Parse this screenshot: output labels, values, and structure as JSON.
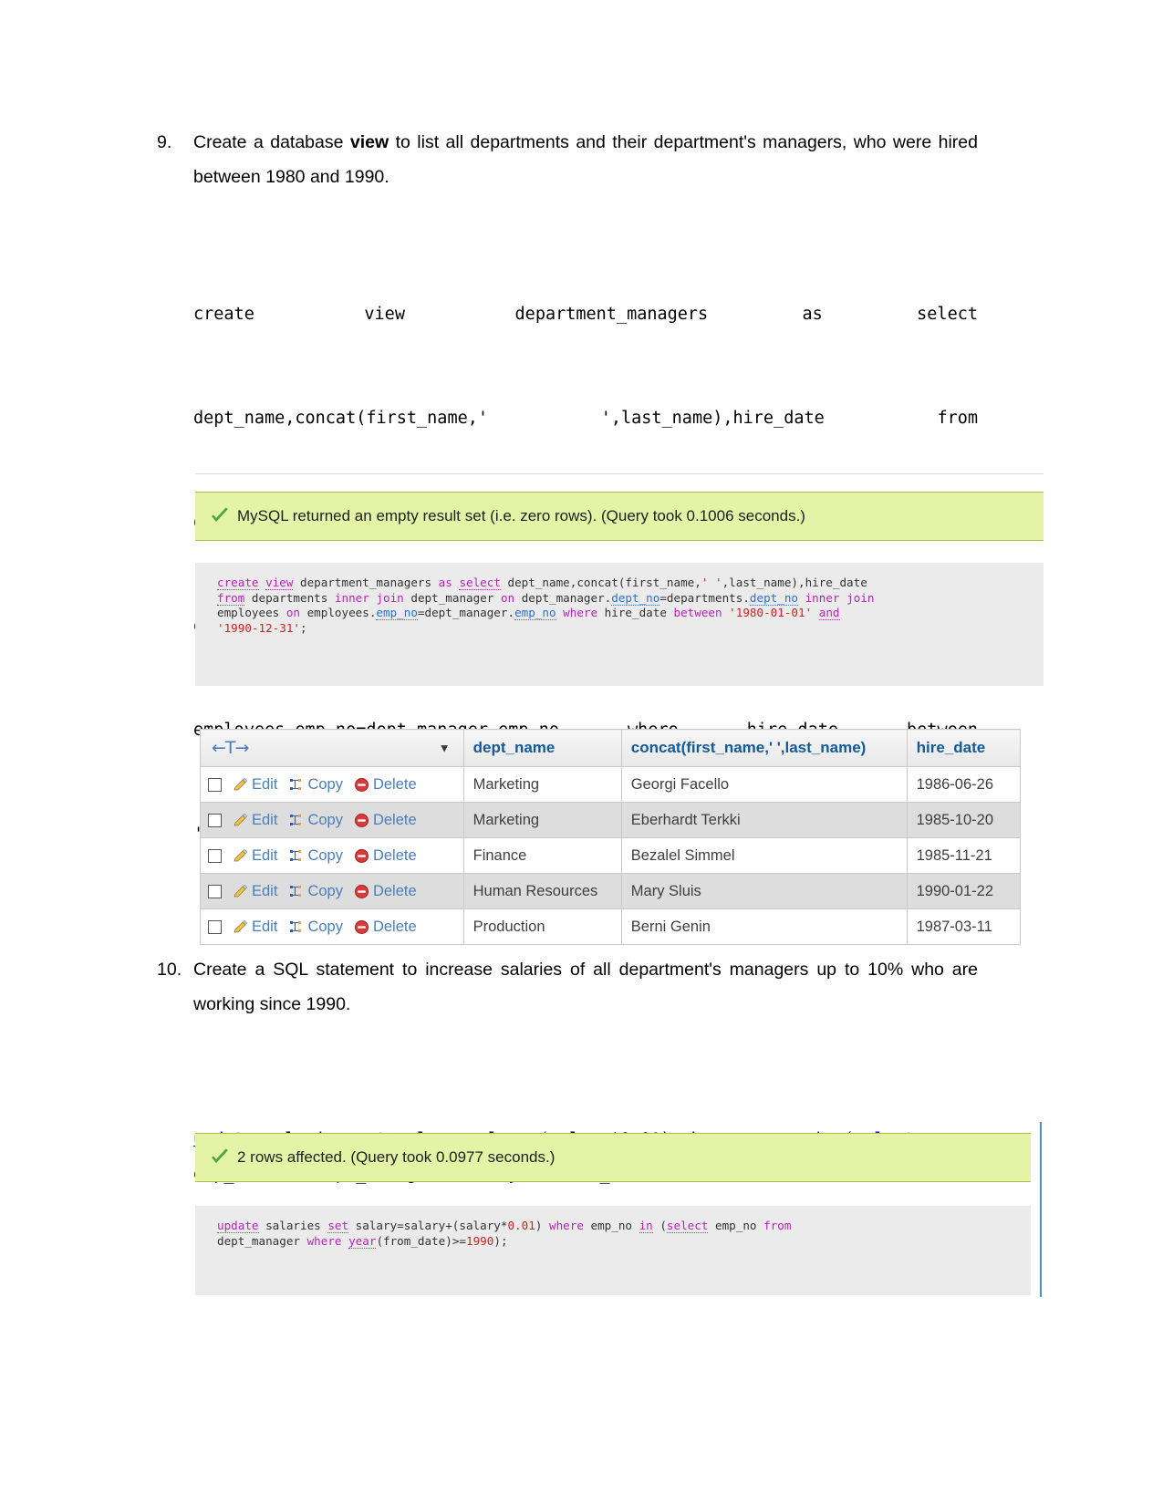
{
  "questions": [
    {
      "number": "9.",
      "text_parts": [
        {
          "t": "Create a database ",
          "b": false
        },
        {
          "t": "view",
          "b": true
        },
        {
          "t": " to list all departments and their department's managers, who were hired between 1980 and 1990.",
          "b": false
        }
      ],
      "full_text": "Create a database view to list all departments and their department's managers, who were hired between 1980 and 1990."
    },
    {
      "number": "10.",
      "text_parts": [
        {
          "t": "Create a SQL statement to increase salaries of all department's managers up to 10% who are working since 1990.",
          "b": false
        }
      ],
      "full_text": "Create a SQL statement to increase salaries of all department's managers up to 10% who are working since 1990."
    }
  ],
  "sql9": {
    "line1": "create       view       department_managers      as      select",
    "line2": "dept_name,concat(first_name,'     ',last_name),hire_date     from",
    "line3": "departments        inner        join        dept_manager        on",
    "line4": "dept_manager.dept_no=departments.dept_no inner join employees on",
    "line5": "employees.emp_no=dept_manager.emp_no   where   hire_date   between",
    "line6": "'1980-01-01' and '1990-12-31';",
    "full": "create view department_managers as select dept_name,concat(first_name,' ',last_name),hire_date from departments inner join dept_manager on dept_manager.dept_no=departments.dept_no inner join employees on employees.emp_no=dept_manager.emp_no where hire_date between '1980-01-01' and '1990-12-31';"
  },
  "sql10": {
    "seg": [
      {
        "t": "update",
        "kw": true
      },
      {
        "t": " salaries ",
        "kw": false
      },
      {
        "t": "set",
        "kw": true
      },
      {
        "t": " salary=salary+(salary*0.01) where emp_no ",
        "kw": false
      },
      {
        "t": "in",
        "kw": true
      },
      {
        "t": " (",
        "kw": false
      },
      {
        "t": "select",
        "kw": true
      },
      {
        "t": " emp_no from dept_manager where ",
        "kw": false
      },
      {
        "t": "year",
        "kw": true
      },
      {
        "t": "(from_date)>=1990);",
        "kw": false
      }
    ],
    "full": "update salaries set salary=salary+(salary*0.01) where emp_no in (select emp_no from dept_manager where year(from_date)>=1990);"
  },
  "result9": {
    "banner": "MySQL returned an empty result set (i.e. zero rows). (Query took 0.1006 seconds.)",
    "check_icon": "green-check-icon",
    "sqlbox": [
      [
        {
          "t": "create",
          "c": "res"
        },
        {
          "t": " ",
          "c": "plain"
        },
        {
          "t": "view",
          "c": "res"
        },
        {
          "t": " department_managers ",
          "c": "plain"
        },
        {
          "t": "as",
          "c": "res2"
        },
        {
          "t": " ",
          "c": "plain"
        },
        {
          "t": "select",
          "c": "res"
        },
        {
          "t": " dept_name,concat(first_name,",
          "c": "plain"
        },
        {
          "t": "' '",
          "c": "str"
        },
        {
          "t": ",last_name),hire_date",
          "c": "plain"
        }
      ],
      [
        {
          "t": "from",
          "c": "res"
        },
        {
          "t": " departments ",
          "c": "plain"
        },
        {
          "t": "inner",
          "c": "res2"
        },
        {
          "t": " ",
          "c": "plain"
        },
        {
          "t": "join",
          "c": "res2"
        },
        {
          "t": " dept_manager ",
          "c": "plain"
        },
        {
          "t": "on",
          "c": "res2"
        },
        {
          "t": " dept_manager.",
          "c": "plain"
        },
        {
          "t": "dept_no",
          "c": "col"
        },
        {
          "t": "=departments.",
          "c": "plain"
        },
        {
          "t": "dept_no",
          "c": "col"
        },
        {
          "t": " ",
          "c": "plain"
        },
        {
          "t": "inner",
          "c": "res2"
        },
        {
          "t": " ",
          "c": "plain"
        },
        {
          "t": "join",
          "c": "res2"
        }
      ],
      [
        {
          "t": "employees ",
          "c": "plain"
        },
        {
          "t": "on",
          "c": "res2"
        },
        {
          "t": " employees.",
          "c": "plain"
        },
        {
          "t": "emp_no",
          "c": "col"
        },
        {
          "t": "=dept_manager.",
          "c": "plain"
        },
        {
          "t": "emp_no",
          "c": "col"
        },
        {
          "t": " ",
          "c": "plain"
        },
        {
          "t": "where",
          "c": "res2"
        },
        {
          "t": " hire_date ",
          "c": "plain"
        },
        {
          "t": "between",
          "c": "res2"
        },
        {
          "t": " ",
          "c": "plain"
        },
        {
          "t": "'1980-01-01'",
          "c": "str"
        },
        {
          "t": " ",
          "c": "plain"
        },
        {
          "t": "and",
          "c": "res"
        }
      ],
      [
        {
          "t": "'1990-12-31'",
          "c": "str"
        },
        {
          "t": ";",
          "c": "plain"
        }
      ]
    ],
    "table": {
      "control_header": "←T→",
      "sort_caret": "▼",
      "columns": [
        "dept_name",
        "concat(first_name,' ',last_name)",
        "hire_date"
      ],
      "row_actions": [
        "Edit",
        "Copy",
        "Delete"
      ],
      "rows": [
        {
          "dept_name": "Marketing",
          "name": "Georgi Facello",
          "hire_date": "1986-06-26"
        },
        {
          "dept_name": "Marketing",
          "name": "Eberhardt Terkki",
          "hire_date": "1985-10-20"
        },
        {
          "dept_name": "Finance",
          "name": "Bezalel Simmel",
          "hire_date": "1985-11-21"
        },
        {
          "dept_name": "Human Resources",
          "name": "Mary Sluis",
          "hire_date": "1990-01-22"
        },
        {
          "dept_name": "Production",
          "name": "Berni Genin",
          "hire_date": "1987-03-11"
        }
      ]
    }
  },
  "result10": {
    "banner": "2 rows affected. (Query took 0.0977 seconds.)",
    "check_icon": "green-check-icon",
    "sqlbox": [
      [
        {
          "t": "update",
          "c": "res"
        },
        {
          "t": " salaries ",
          "c": "plain"
        },
        {
          "t": "set",
          "c": "res"
        },
        {
          "t": " salary=salary+(salary*",
          "c": "plain"
        },
        {
          "t": "0.01",
          "c": "str"
        },
        {
          "t": ") ",
          "c": "plain"
        },
        {
          "t": "where",
          "c": "res2"
        },
        {
          "t": " emp_no ",
          "c": "plain"
        },
        {
          "t": "in",
          "c": "res"
        },
        {
          "t": " (",
          "c": "plain"
        },
        {
          "t": "select",
          "c": "res"
        },
        {
          "t": " emp_no ",
          "c": "plain"
        },
        {
          "t": "from",
          "c": "res2"
        }
      ],
      [
        {
          "t": "dept_manager ",
          "c": "plain"
        },
        {
          "t": "where",
          "c": "res2"
        },
        {
          "t": " ",
          "c": "plain"
        },
        {
          "t": "year",
          "c": "res"
        },
        {
          "t": "(from_date)>=",
          "c": "plain"
        },
        {
          "t": "1990",
          "c": "str"
        },
        {
          "t": ");",
          "c": "plain"
        }
      ]
    ]
  },
  "colors": {
    "banner_bg": "#e5f3a6",
    "banner_border": "#a9c23f",
    "sqlbox_bg": "#ebebeb",
    "table_header_text": "#135a96",
    "link_blue": "#4a7ebb",
    "keyword_blue": "#0000EE",
    "highlight_magenta": "#bb22bb",
    "highlight_column": "#2d6fd6",
    "highlight_string": "#cc2222",
    "row_even_bg": "#dddddd",
    "rail_blue": "#4a90c4"
  }
}
